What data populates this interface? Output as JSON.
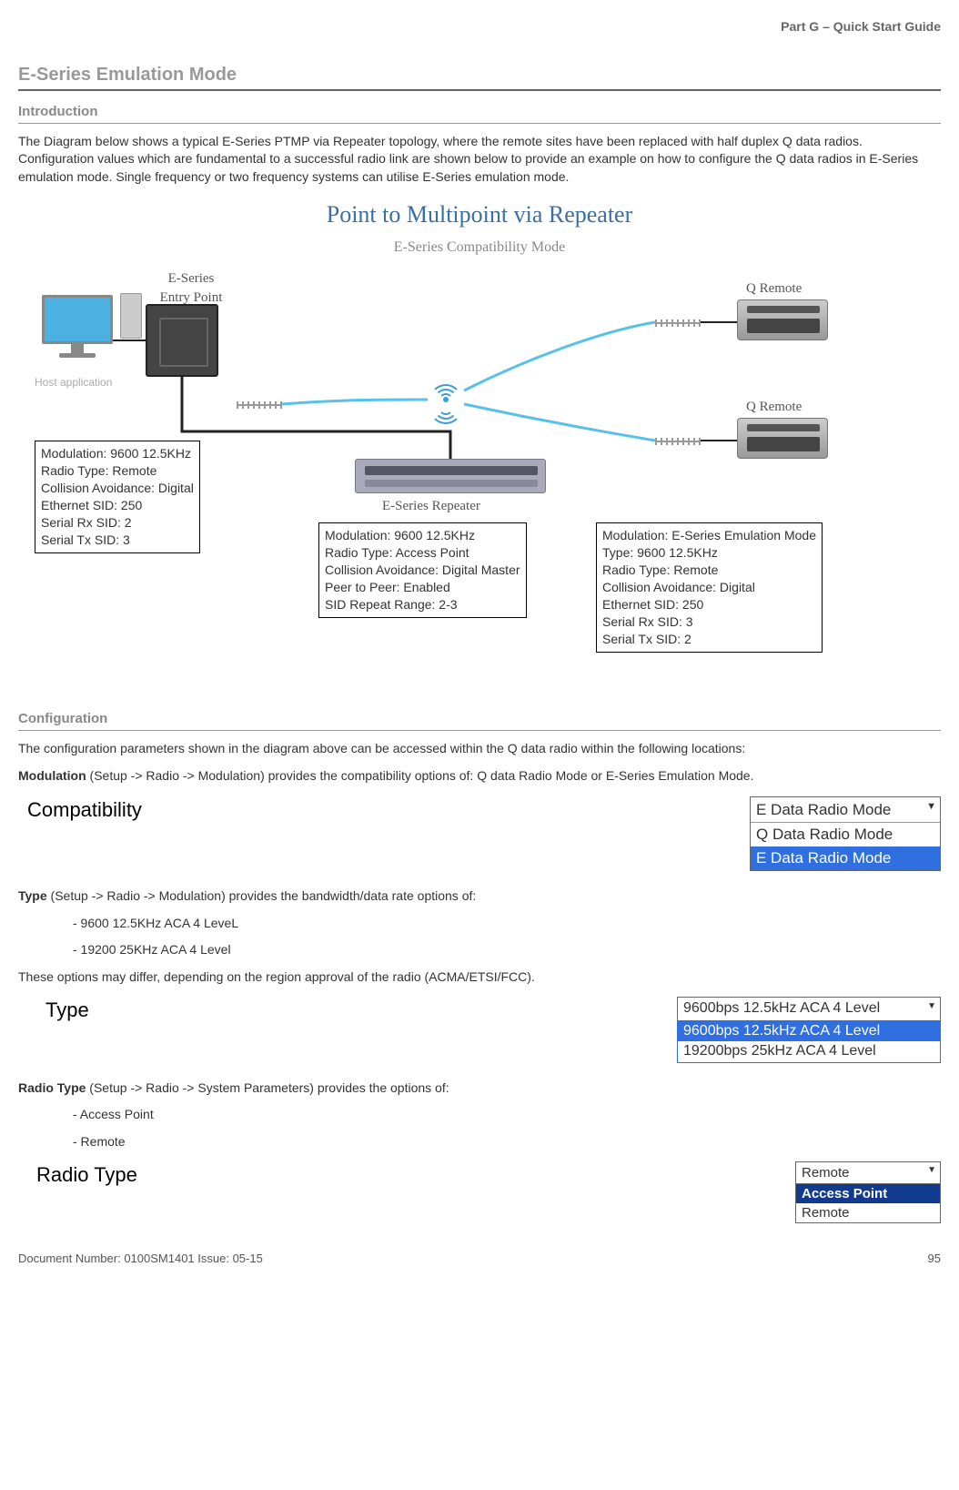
{
  "header": {
    "part": "Part G – Quick Start Guide"
  },
  "section_title": "E-Series Emulation Mode",
  "intro_heading": "Introduction",
  "intro_text": "The Diagram below shows a typical E-Series PTMP via Repeater topology, where the remote sites have been replaced with half duplex Q data radios. Configuration values which are fundamental to a successful radio link are shown below to provide an example on how to configure the Q data radios in E-Series emulation mode. Single frequency or two frequency systems can utilise E-Series emulation mode.",
  "diagram": {
    "title": "Point to Multipoint via Repeater",
    "subtitle": "E-Series Compatibility Mode",
    "host_label": "Host application",
    "entry_label": "E-Series\nEntry Point",
    "repeater_label": "E-Series Repeater",
    "remote_label": "Q Remote",
    "box_entry": [
      "Modulation: 9600 12.5KHz",
      "Radio Type: Remote",
      "Collision Avoidance: Digital",
      "Ethernet SID: 250",
      "Serial Rx SID: 2",
      "Serial Tx SID: 3"
    ],
    "box_repeater": [
      "Modulation: 9600 12.5KHz",
      "Radio Type: Access Point",
      "Collision Avoidance: Digital Master",
      "Peer to Peer: Enabled",
      "SID Repeat Range: 2-3"
    ],
    "box_remote": [
      "Modulation: E-Series Emulation Mode",
      "Type: 9600 12.5KHz",
      "Radio Type: Remote",
      "Collision Avoidance: Digital",
      "Ethernet SID: 250",
      "Serial Rx SID: 3",
      "Serial Tx SID: 2"
    ]
  },
  "config_heading": "Configuration",
  "config_intro": "The configuration parameters shown in the diagram above can be accessed within the Q data radio within the following locations:",
  "modulation_label": "Modulation",
  "modulation_text": " (Setup -> Radio -> Modulation) provides the compatibility options of: Q data Radio Mode or E-Series Emulation Mode.",
  "compat_label": "Compatibility",
  "compat_selected": "E Data Radio Mode",
  "compat_options": [
    "Q Data Radio Mode",
    "E Data Radio Mode"
  ],
  "type_label_b": "Type",
  "type_text": " (Setup -> Radio -> Modulation) provides the bandwidth/data rate options of:",
  "type_opts_list": [
    "- 9600 12.5KHz ACA 4 LeveL",
    "- 19200 25KHz ACA 4 Level"
  ],
  "type_note": "These options may differ, depending on the region approval of the radio (ACMA/ETSI/FCC).",
  "type_field_label": "Type",
  "type_selected": "9600bps 12.5kHz ACA 4 Level",
  "type_dd_opts": [
    "9600bps 12.5kHz ACA 4 Level",
    "19200bps 25kHz ACA 4 Level"
  ],
  "radiotype_label_b": "Radio Type",
  "radiotype_text": " (Setup -> Radio -> System Parameters) provides the options of:",
  "radiotype_list": [
    "- Access Point",
    "- Remote"
  ],
  "radiotype_field_label": "Radio Type",
  "radiotype_selected": "Remote",
  "radiotype_dd_opts": [
    "Access Point",
    "Remote"
  ],
  "footer": {
    "left": "Document Number: 0100SM1401   Issue: 05-15",
    "right": "95"
  }
}
